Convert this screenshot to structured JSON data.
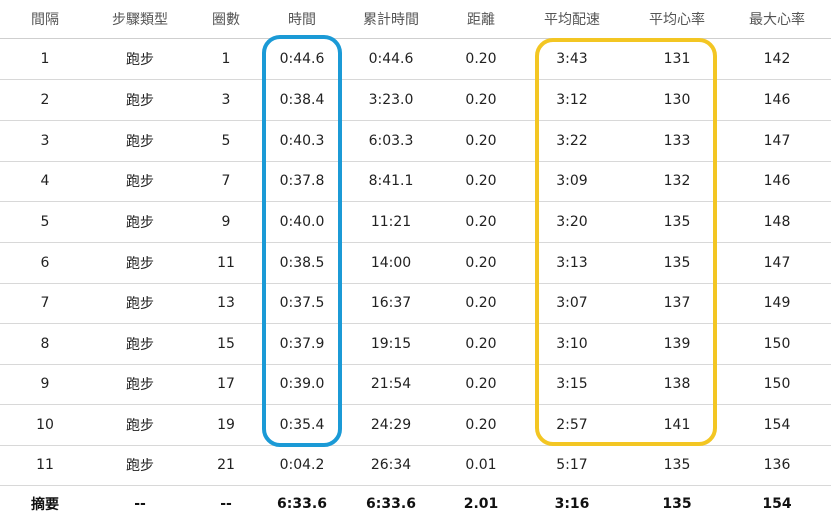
{
  "table": {
    "headers": [
      "間隔",
      "步驟類型",
      "圈數",
      "時間",
      "累計時間",
      "距離",
      "平均配速",
      "平均心率",
      "最大心率"
    ],
    "rows": [
      [
        "1",
        "跑步",
        "1",
        "0:44.6",
        "0:44.6",
        "0.20",
        "3:43",
        "131",
        "142"
      ],
      [
        "2",
        "跑步",
        "3",
        "0:38.4",
        "3:23.0",
        "0.20",
        "3:12",
        "130",
        "146"
      ],
      [
        "3",
        "跑步",
        "5",
        "0:40.3",
        "6:03.3",
        "0.20",
        "3:22",
        "133",
        "147"
      ],
      [
        "4",
        "跑步",
        "7",
        "0:37.8",
        "8:41.1",
        "0.20",
        "3:09",
        "132",
        "146"
      ],
      [
        "5",
        "跑步",
        "9",
        "0:40.0",
        "11:21",
        "0.20",
        "3:20",
        "135",
        "148"
      ],
      [
        "6",
        "跑步",
        "11",
        "0:38.5",
        "14:00",
        "0.20",
        "3:13",
        "135",
        "147"
      ],
      [
        "7",
        "跑步",
        "13",
        "0:37.5",
        "16:37",
        "0.20",
        "3:07",
        "137",
        "149"
      ],
      [
        "8",
        "跑步",
        "15",
        "0:37.9",
        "19:15",
        "0.20",
        "3:10",
        "139",
        "150"
      ],
      [
        "9",
        "跑步",
        "17",
        "0:39.0",
        "21:54",
        "0.20",
        "3:15",
        "138",
        "150"
      ],
      [
        "10",
        "跑步",
        "19",
        "0:35.4",
        "24:29",
        "0.20",
        "2:57",
        "141",
        "154"
      ],
      [
        "11",
        "跑步",
        "21",
        "0:04.2",
        "26:34",
        "0.01",
        "5:17",
        "135",
        "136"
      ]
    ],
    "summary": [
      "摘要",
      "--",
      "--",
      "6:33.6",
      "6:33.6",
      "2.01",
      "3:16",
      "135",
      "154"
    ]
  },
  "highlights": {
    "time_column_color": "#1b9ad6",
    "pace_hr_columns_color": "#f3c623"
  }
}
